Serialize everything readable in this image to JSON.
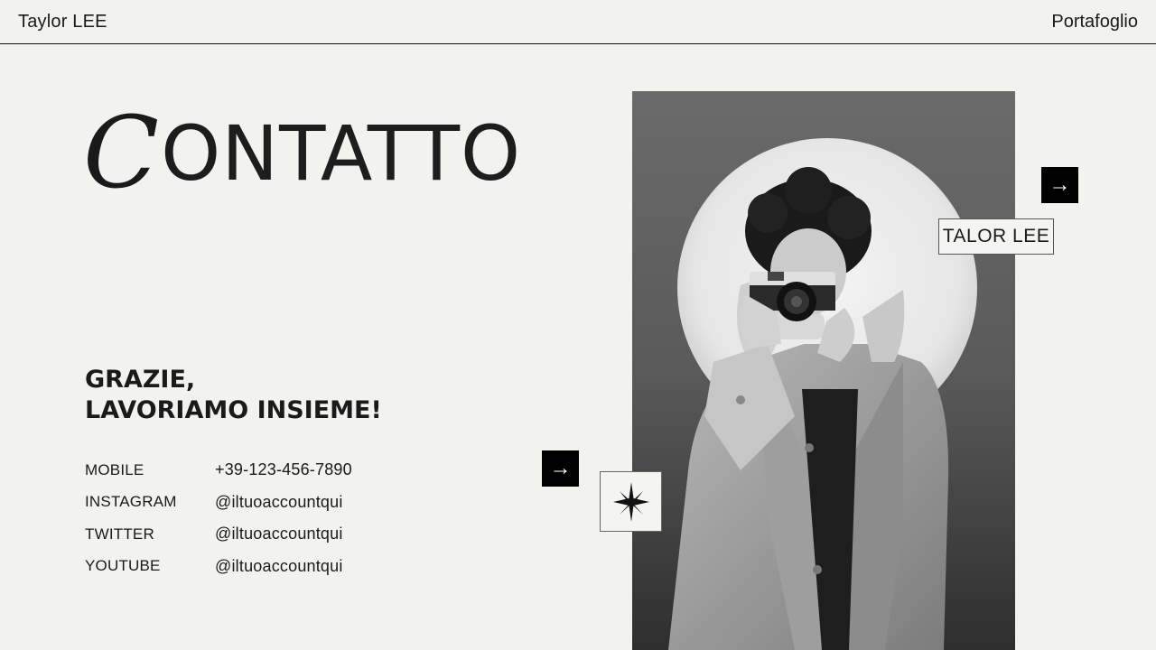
{
  "header": {
    "brand": "Taylor LEE",
    "nav_label": "Portafoglio"
  },
  "hero": {
    "title_initial": "C",
    "title_rest": "ONTATTO"
  },
  "thanks": {
    "line1": "GRAZIE,",
    "line2": "LAVORIAMO INSIEME!"
  },
  "contacts": [
    {
      "label": "MOBILE",
      "value": "+39-123-456-7890"
    },
    {
      "label": "INSTAGRAM",
      "value": "@iltuoaccountqui"
    },
    {
      "label": "TWITTER",
      "value": "@iltuoaccountqui"
    },
    {
      "label": "YOUTUBE",
      "value": "@iltuoaccountqui"
    }
  ],
  "photo": {
    "name_tag": "TALOR LEE"
  },
  "icons": {
    "arrow_glyph": "→",
    "arrow_name": "arrow-right-icon",
    "star_name": "sparkle-star-icon"
  },
  "colors": {
    "background": "#f2f2ee",
    "text": "#1a1a1a",
    "button": "#000000"
  }
}
